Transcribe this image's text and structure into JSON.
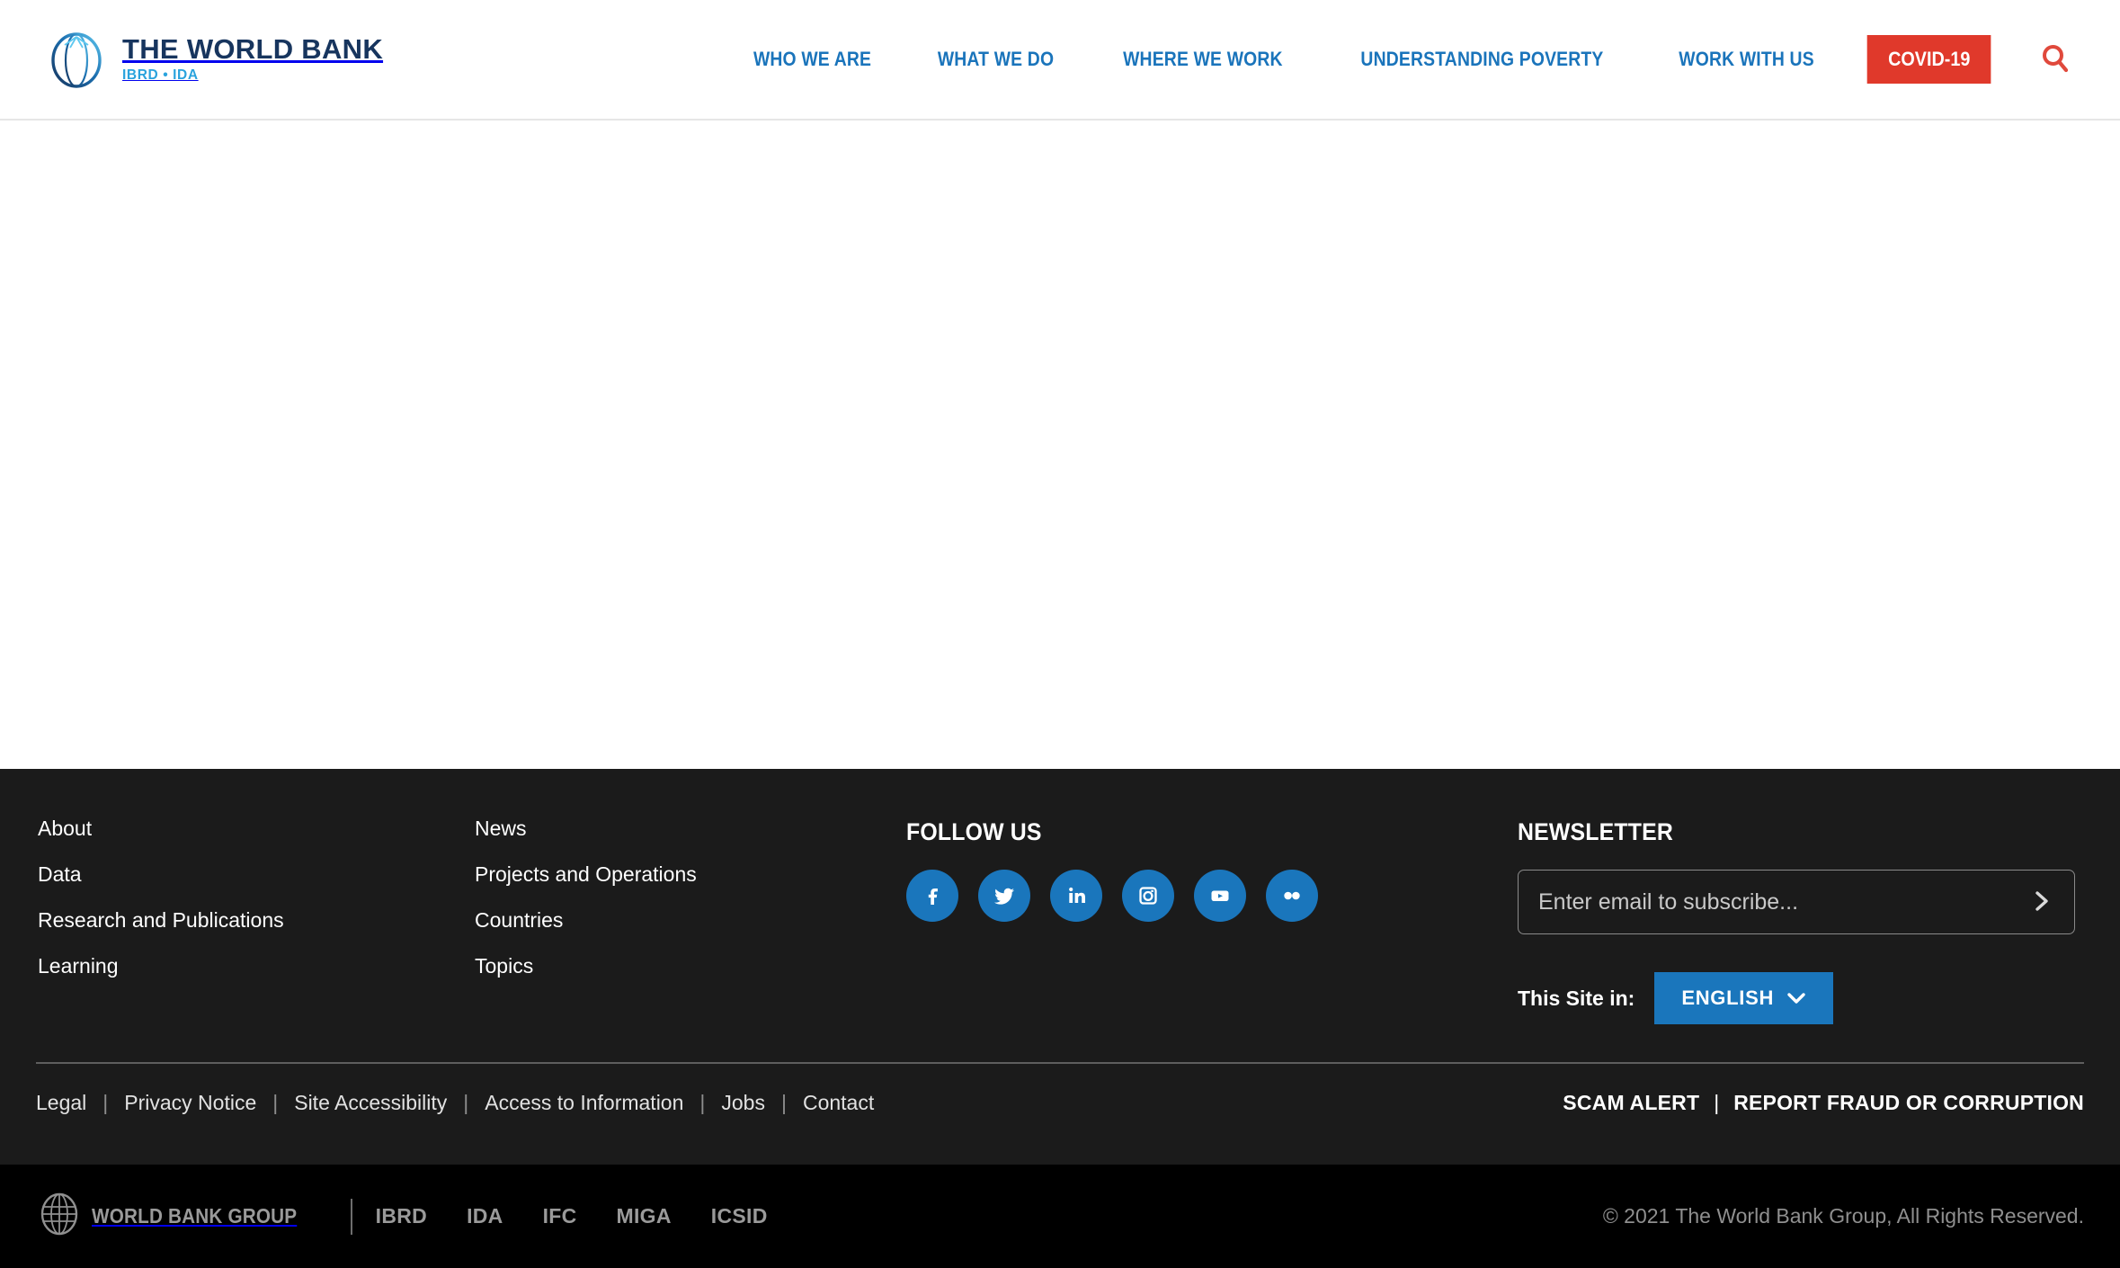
{
  "header": {
    "logo": {
      "icon": "world-bank-globe-icon",
      "title": "THE WORLD BANK",
      "subtitle": "IBRD • IDA"
    },
    "nav_items": [
      {
        "label": "WHO WE ARE"
      },
      {
        "label": "WHAT WE DO"
      },
      {
        "label": "WHERE WE WORK"
      },
      {
        "label": "UNDERSTANDING POVERTY"
      },
      {
        "label": "WORK WITH US"
      }
    ],
    "covid_button": {
      "label": "COVID-19",
      "color": "#e0392b"
    },
    "search": {
      "icon": "search-icon",
      "color": "#e0493c"
    },
    "link_color": "#1a74bb"
  },
  "footer": {
    "column_1": [
      {
        "label": "About"
      },
      {
        "label": "Data"
      },
      {
        "label": "Research and Publications"
      },
      {
        "label": "Learning"
      }
    ],
    "column_2": [
      {
        "label": "News"
      },
      {
        "label": "Projects and Operations"
      },
      {
        "label": "Countries"
      },
      {
        "label": "Topics"
      }
    ],
    "follow": {
      "heading": "FOLLOW US",
      "networks": [
        {
          "name": "facebook-icon"
        },
        {
          "name": "twitter-icon"
        },
        {
          "name": "linkedin-icon"
        },
        {
          "name": "instagram-icon"
        },
        {
          "name": "youtube-icon"
        },
        {
          "name": "flickr-icon"
        }
      ]
    },
    "newsletter": {
      "heading": "NEWSLETTER",
      "placeholder": "Enter email to subscribe...",
      "value": "",
      "submit_icon": "chevron-right-icon"
    },
    "language": {
      "label": "This Site in:",
      "selected": "ENGLISH",
      "chevron_icon": "chevron-down-icon",
      "color": "#1a76bc"
    },
    "legal_links": [
      {
        "label": "Legal"
      },
      {
        "label": "Privacy Notice"
      },
      {
        "label": "Site Accessibility"
      },
      {
        "label": "Access to Information"
      },
      {
        "label": "Jobs"
      },
      {
        "label": "Contact"
      }
    ],
    "legal_separator": "|",
    "alerts": [
      {
        "label": "SCAM ALERT"
      },
      {
        "label": "REPORT FRAUD OR CORRUPTION"
      }
    ],
    "alert_separator": "|"
  },
  "bottom_bar": {
    "group_logo": {
      "icon": "world-bank-group-globe-icon",
      "name": "WORLD BANK GROUP"
    },
    "institutions": [
      {
        "label": "IBRD"
      },
      {
        "label": "IDA"
      },
      {
        "label": "IFC"
      },
      {
        "label": "MIGA"
      },
      {
        "label": "ICSID"
      }
    ],
    "copyright": "© 2021 The World Bank Group, All Rights Reserved."
  }
}
